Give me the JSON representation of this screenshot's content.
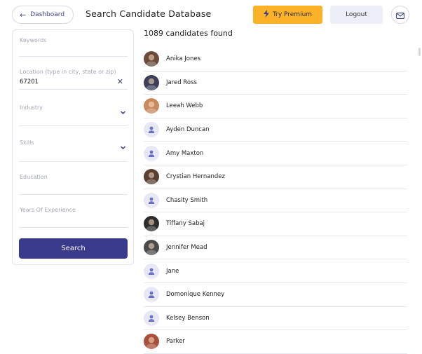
{
  "header": {
    "dashboard_label": "Dashboard",
    "title": "Search Candidate Database",
    "premium_label": "Try Premium",
    "logout_label": "Logout"
  },
  "filters": {
    "keywords_placeholder": "Keywords",
    "location_placeholder": "Location (type in city, state or zip)",
    "location_value": "67201",
    "industry_placeholder": "Industry",
    "skills_placeholder": "Skills",
    "education_placeholder": "Education",
    "experience_placeholder": "Years Of Experience",
    "search_label": "Search"
  },
  "results": {
    "count_text": "1089 candidates found",
    "candidates": [
      {
        "name": "Anika Jones",
        "avatar": "photo"
      },
      {
        "name": "Jared Ross",
        "avatar": "photo"
      },
      {
        "name": "Leeah Webb",
        "avatar": "photo"
      },
      {
        "name": "Ayden Duncan",
        "avatar": "default"
      },
      {
        "name": "Amy Maxton",
        "avatar": "default"
      },
      {
        "name": "Crystian Hernandez",
        "avatar": "photo"
      },
      {
        "name": "Chasity Smith",
        "avatar": "default"
      },
      {
        "name": "Tiffany Sabaj",
        "avatar": "photo"
      },
      {
        "name": "Jennifer Mead",
        "avatar": "photo"
      },
      {
        "name": "Jane",
        "avatar": "default"
      },
      {
        "name": "Domonique Kenney",
        "avatar": "default"
      },
      {
        "name": "Kelsey Benson",
        "avatar": "default"
      },
      {
        "name": "Parker",
        "avatar": "photo"
      }
    ]
  },
  "colors": {
    "accent": "#3a3a8c",
    "premium": "#fbb128",
    "logout_bg": "#eceef8"
  }
}
